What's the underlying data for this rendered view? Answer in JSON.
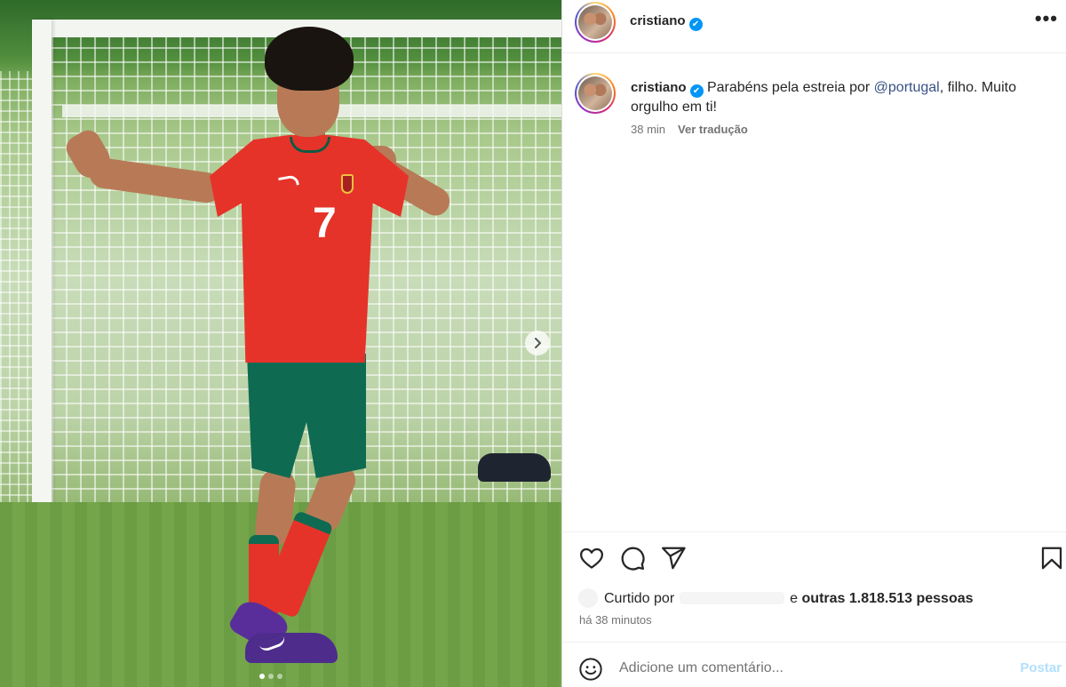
{
  "post": {
    "username": "cristiano",
    "verified_mark": "✔",
    "more_label": "•••",
    "caption_before": "Parabéns pela estreia por ",
    "caption_mention": "@portugal",
    "caption_after": ", filho. Muito orgulho em ti!",
    "time_short": "38 min",
    "translate_label": "Ver tradução",
    "jersey_number": "7",
    "carousel_index": 1,
    "carousel_total": 3
  },
  "likes": {
    "prefix": "Curtido por",
    "suffix": "e",
    "count_text": "outras 1.818.513 pessoas"
  },
  "time_ago": "há 38 minutos",
  "comment": {
    "placeholder": "Adicione um comentário...",
    "post_label": "Postar"
  },
  "icons": [
    "more-icon",
    "chevron-right-icon",
    "heart-icon",
    "comment-icon",
    "share-icon",
    "bookmark-icon",
    "emoji-icon",
    "verified-icon"
  ],
  "colors": {
    "link": "#385185",
    "verified": "#0095f6",
    "post_button": "#b2dffc",
    "muted": "#737373"
  }
}
